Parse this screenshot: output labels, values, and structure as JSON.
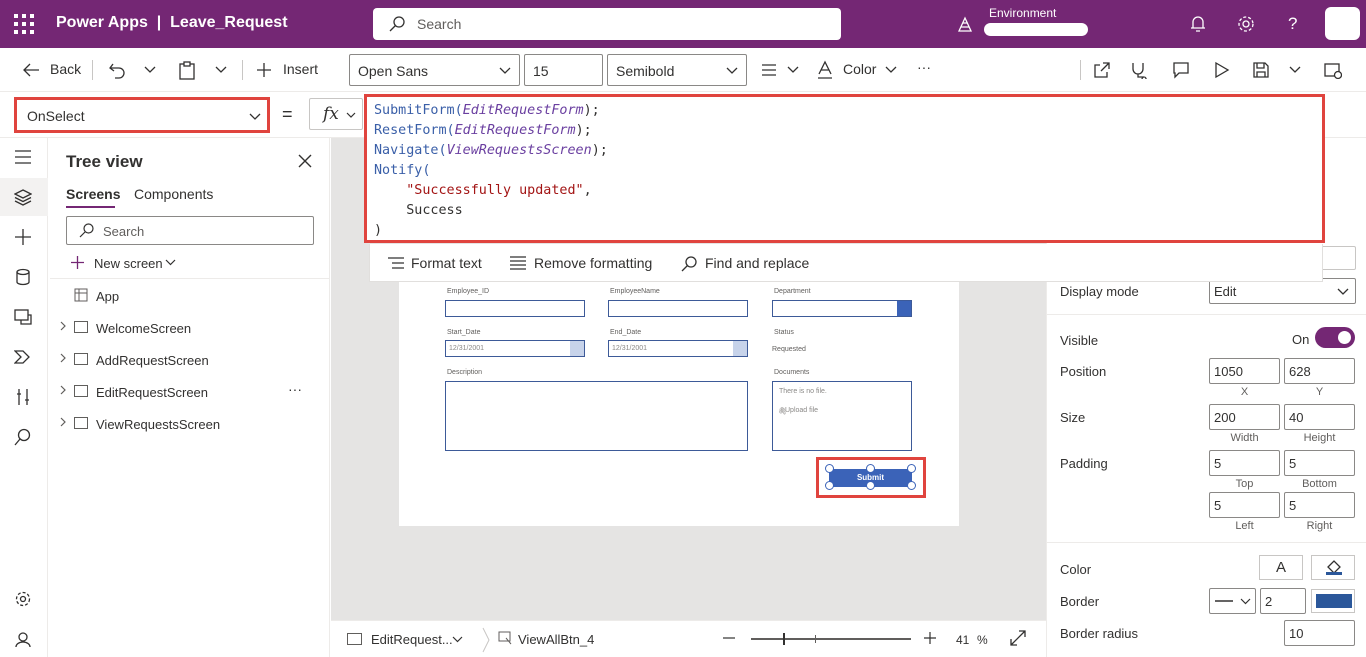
{
  "app": {
    "product": "Power Apps",
    "separator": "|",
    "name": "Leave_Request"
  },
  "topbar": {
    "search_placeholder": "Search",
    "environment_label": "Environment",
    "background": "#742774"
  },
  "cmdbar": {
    "back": "Back",
    "insert": "Insert",
    "font": "Open Sans",
    "font_size": "15",
    "font_weight": "Semibold",
    "color": "Color",
    "more": "···"
  },
  "formula": {
    "property": "OnSelect",
    "equals": "=",
    "fx": "fx",
    "lines": [
      [
        {
          "t": "SubmitForm(",
          "c": "kfn"
        },
        {
          "t": "EditRequestForm",
          "c": "karg"
        },
        {
          "t": ");",
          "c": "kpl"
        }
      ],
      [
        {
          "t": "ResetForm(",
          "c": "kfn"
        },
        {
          "t": "EditRequestForm",
          "c": "karg"
        },
        {
          "t": ");",
          "c": "kpl"
        }
      ],
      [
        {
          "t": "Navigate(",
          "c": "kfn"
        },
        {
          "t": "ViewRequestsScreen",
          "c": "karg"
        },
        {
          "t": ");",
          "c": "kpl"
        }
      ],
      [
        {
          "t": "Notify(",
          "c": "kfn"
        }
      ],
      [
        {
          "t": "    ",
          "c": "kpl"
        },
        {
          "t": "\"Successfully updated\"",
          "c": "kstr"
        },
        {
          "t": ",",
          "c": "kpl"
        }
      ],
      [
        {
          "t": "    Success",
          "c": "kpl"
        }
      ],
      [
        {
          "t": ")",
          "c": "kpl"
        }
      ]
    ],
    "toolbar": {
      "format_text": "Format text",
      "remove_formatting": "Remove formatting",
      "find_replace": "Find and replace"
    }
  },
  "tree": {
    "title": "Tree view",
    "tabs": [
      "Screens",
      "Components"
    ],
    "search_placeholder": "Search",
    "new_screen": "New screen",
    "app_node": "App",
    "screens": [
      "WelcomeScreen",
      "AddRequestScreen",
      "EditRequestScreen",
      "ViewRequestsScreen"
    ],
    "more": "···"
  },
  "form": {
    "employee_id": "Employee_ID",
    "employee_name": "EmployeeName",
    "department": "Department",
    "start_date": "Start_Date",
    "end_date": "End_Date",
    "status": "Status",
    "status_value": "Requested",
    "start_value": "12/31/2001",
    "end_value": "12/31/2001",
    "description": "Description",
    "documents": "Documents",
    "no_file": "There is no file.",
    "upload": "Upload file",
    "submit": "Submit"
  },
  "statusbar": {
    "screen": "EditRequest...",
    "control": "ViewAllBtn_4",
    "zoom": "41",
    "zoom_unit": "%",
    "zoom_fraction": 0.41
  },
  "props": {
    "display_mode_label": "Display mode",
    "display_mode_value": "Edit",
    "visible_label": "Visible",
    "visible_value": "On",
    "position_label": "Position",
    "x": "1050",
    "y": "628",
    "x_label": "X",
    "y_label": "Y",
    "size_label": "Size",
    "width": "200",
    "height": "40",
    "width_label": "Width",
    "height_label": "Height",
    "padding_label": "Padding",
    "pad_top": "5",
    "pad_bottom": "5",
    "pad_left": "5",
    "pad_right": "5",
    "top_label": "Top",
    "bottom_label": "Bottom",
    "left_label": "Left",
    "right_label": "Right",
    "color_label": "Color",
    "color_letter": "A",
    "border_label": "Border",
    "border_width": "2",
    "border_color": "#2b579a",
    "border_radius_label": "Border radius",
    "border_radius": "10"
  }
}
